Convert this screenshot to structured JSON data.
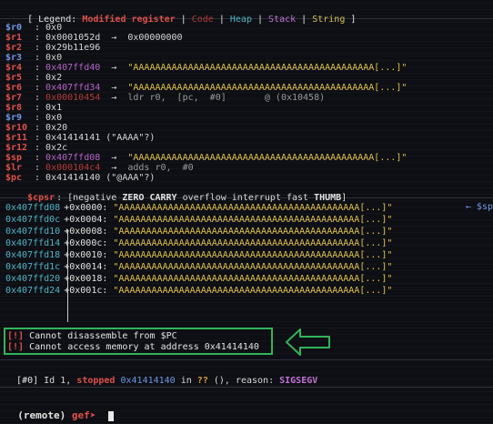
{
  "legend": {
    "open": "[ Legend: ",
    "modified": "Modified register",
    "bar1": " | ",
    "code": "Code",
    "bar2": " | ",
    "heap": "Heap",
    "bar3": " | ",
    "stack": "Stack",
    "bar4": " | ",
    "string": "String",
    "close": " ]"
  },
  "registers": [
    {
      "name": "$r0",
      "color": "blue",
      "value": ": 0x0",
      "rest": ""
    },
    {
      "name": "$r1",
      "color": "red",
      "value": ": 0x0001052d  →  0x00000000",
      "rest": ""
    },
    {
      "name": "$r2",
      "color": "red",
      "value": ": 0x29b11e96",
      "rest": ""
    },
    {
      "name": "$r3",
      "color": "blue",
      "value": ": 0x0",
      "rest": ""
    },
    {
      "name": "$r4",
      "color": "red",
      "addr": "0x407ffd40",
      "addrcolor": "purple",
      "arrow": "  →  ",
      "str": "\"AAAAAAAAAAAAAAAAAAAAAAAAAAAAAAAAAAAAAAAAAAAA[...]\""
    },
    {
      "name": "$r5",
      "color": "red",
      "value": ": 0x2",
      "rest": ""
    },
    {
      "name": "$r6",
      "color": "red",
      "addr": "0x407ffd34",
      "addrcolor": "purple",
      "arrow": "  →  ",
      "str": "\"AAAAAAAAAAAAAAAAAAAAAAAAAAAAAAAAAAAAAAAAAAAA[...]\""
    },
    {
      "name": "$r7",
      "color": "red",
      "addr": "0x00010454",
      "addrcolor": "red",
      "arrow": "  →  ",
      "code": "ldr r0,  [pc,  #0]       @ (0x10458)"
    },
    {
      "name": "$r8",
      "color": "red",
      "value": ": 0x1",
      "rest": ""
    },
    {
      "name": "$r9",
      "color": "blue",
      "value": ": 0x0",
      "rest": ""
    },
    {
      "name": "$r10",
      "color": "red",
      "value": ": 0x20",
      "rest": ""
    },
    {
      "name": "$r11",
      "color": "red",
      "value": ": 0x41414141 (\"AAAA\"?)",
      "rest": ""
    },
    {
      "name": "$r12",
      "color": "red",
      "value": ": 0x2c",
      "rest": ""
    },
    {
      "name": "$sp",
      "color": "red",
      "addr": "0x407ffd08",
      "addrcolor": "purple",
      "arrow": "  →  ",
      "str": "\"AAAAAAAAAAAAAAAAAAAAAAAAAAAAAAAAAAAAAAAAAAAA[...]\""
    },
    {
      "name": "$lr",
      "color": "red",
      "addr": "0x000104c4",
      "addrcolor": "red",
      "arrow": "  →  ",
      "code": "adds r0,  #0"
    },
    {
      "name": "$pc",
      "color": "red",
      "value": ": 0x41414140 (\"@AAA\"?)",
      "rest": ""
    }
  ],
  "cpsr": {
    "name": "$cpsr",
    "pre": ": [negative ",
    "zero": "ZERO",
    "sp1": " ",
    "carry": "CARRY",
    "mid": " overflow interrupt fast ",
    "thumb": "THUMB",
    "end": "]"
  },
  "stack": {
    "sp_tag": "← $sp",
    "rows": [
      {
        "addr": "0x407ffd08",
        "off": "+0x0000:",
        "str": "\"AAAAAAAAAAAAAAAAAAAAAAAAAAAAAAAAAAAAAAAAAAAA[...]\""
      },
      {
        "addr": "0x407ffd0c",
        "off": "+0x0004:",
        "str": "\"AAAAAAAAAAAAAAAAAAAAAAAAAAAAAAAAAAAAAAAAAAAA[...]\""
      },
      {
        "addr": "0x407ffd10",
        "off": "+0x0008:",
        "str": "\"AAAAAAAAAAAAAAAAAAAAAAAAAAAAAAAAAAAAAAAAAAAA[...]\""
      },
      {
        "addr": "0x407ffd14",
        "off": "+0x000c:",
        "str": "\"AAAAAAAAAAAAAAAAAAAAAAAAAAAAAAAAAAAAAAAAAAAA[...]\""
      },
      {
        "addr": "0x407ffd18",
        "off": "+0x0010:",
        "str": "\"AAAAAAAAAAAAAAAAAAAAAAAAAAAAAAAAAAAAAAAAAAAA[...]\""
      },
      {
        "addr": "0x407ffd1c",
        "off": "+0x0014:",
        "str": "\"AAAAAAAAAAAAAAAAAAAAAAAAAAAAAAAAAAAAAAAAAAAA[...]\""
      },
      {
        "addr": "0x407ffd20",
        "off": "+0x0018:",
        "str": "\"AAAAAAAAAAAAAAAAAAAAAAAAAAAAAAAAAAAAAAAAAAAA[...]\""
      },
      {
        "addr": "0x407ffd24",
        "off": "+0x001c:",
        "str": "\"AAAAAAAAAAAAAAAAAAAAAAAAAAAAAAAAAAAAAAAAAAAA[...]\""
      }
    ]
  },
  "errors": [
    {
      "tag": "[!]",
      "msg": " Cannot disassemble from $PC"
    },
    {
      "tag": "[!]",
      "msg": " Cannot access memory at address 0x41414140"
    }
  ],
  "thread": {
    "id": "[#0]",
    "pre": " Id 1, ",
    "stopped": "stopped",
    "sp": " ",
    "addr": "0x41414140",
    "in": " in ",
    "qq": "??",
    "reason": " (), reason: ",
    "signal": "SIGSEGV"
  },
  "prompt": {
    "remote": "(remote)",
    "sp": " ",
    "gef": "gef➤",
    "sp2": "  "
  },
  "colors": {
    "highlight_box": "#31b35a",
    "arrow": "#31b35a"
  }
}
